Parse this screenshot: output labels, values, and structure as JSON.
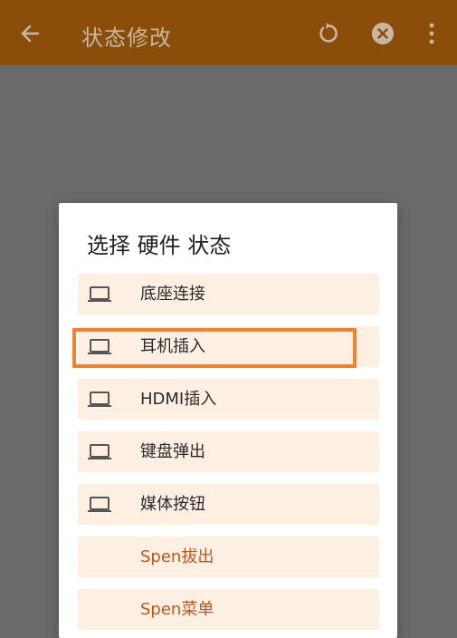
{
  "appbar": {
    "title": "状态修改",
    "back_icon": "arrow-left-icon",
    "refresh_icon": "refresh-icon",
    "close_icon": "close-circle-icon",
    "more_icon": "more-vert-icon",
    "color": "#8a4e0a"
  },
  "dialog": {
    "title": "选择 硬件 状态",
    "items": [
      {
        "label": "底座连接",
        "icon": "laptop-icon"
      },
      {
        "label": "耳机插入",
        "icon": "laptop-icon",
        "highlighted": true
      },
      {
        "label": "HDMI插入",
        "icon": "laptop-icon"
      },
      {
        "label": "键盘弹出",
        "icon": "laptop-icon"
      },
      {
        "label": "媒体按钮",
        "icon": "laptop-icon"
      },
      {
        "label": "Spen拔出",
        "icon": ""
      },
      {
        "label": "Spen菜单",
        "icon": ""
      }
    ]
  },
  "colors": {
    "item_bg": "#fdf0e3",
    "accent_text": "#c0561f",
    "highlight_border": "#f0822f",
    "scrim": "#6b696a"
  }
}
